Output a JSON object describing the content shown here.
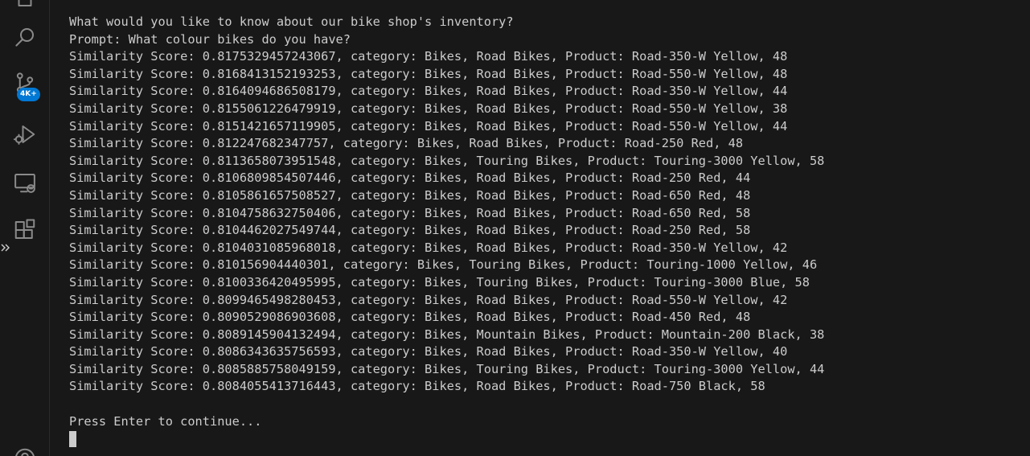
{
  "activity_bar": {
    "icons": [
      "explorer-icon",
      "search-icon",
      "source-control-icon",
      "run-and-debug-icon",
      "remote-explorer-icon",
      "extensions-icon",
      "accounts-icon"
    ],
    "source_control_badge": "4K+",
    "badge_color": "#0078d4"
  },
  "terminal": {
    "header_lines": [
      "What would you like to know about our bike shop's inventory?",
      "Prompt: What colour bikes do you have?"
    ],
    "results": [
      "Similarity Score: 0.8175329457243067, category: Bikes, Road Bikes, Product: Road-350-W Yellow, 48",
      "Similarity Score: 0.8168413152193253, category: Bikes, Road Bikes, Product: Road-550-W Yellow, 48",
      "Similarity Score: 0.8164094686508179, category: Bikes, Road Bikes, Product: Road-350-W Yellow, 44",
      "Similarity Score: 0.8155061226479919, category: Bikes, Road Bikes, Product: Road-550-W Yellow, 38",
      "Similarity Score: 0.8151421657119905, category: Bikes, Road Bikes, Product: Road-550-W Yellow, 44",
      "Similarity Score: 0.812247682347757, category: Bikes, Road Bikes, Product: Road-250 Red, 48",
      "Similarity Score: 0.8113658073951548, category: Bikes, Touring Bikes, Product: Touring-3000 Yellow, 58",
      "Similarity Score: 0.8106809854507446, category: Bikes, Road Bikes, Product: Road-250 Red, 44",
      "Similarity Score: 0.8105861657508527, category: Bikes, Road Bikes, Product: Road-650 Red, 48",
      "Similarity Score: 0.8104758632750406, category: Bikes, Road Bikes, Product: Road-650 Red, 58",
      "Similarity Score: 0.8104462027549744, category: Bikes, Road Bikes, Product: Road-250 Red, 58",
      "Similarity Score: 0.8104031085968018, category: Bikes, Road Bikes, Product: Road-350-W Yellow, 42",
      "Similarity Score: 0.810156904440301, category: Bikes, Touring Bikes, Product: Touring-1000 Yellow, 46",
      "Similarity Score: 0.8100336420495995, category: Bikes, Touring Bikes, Product: Touring-3000 Blue, 58",
      "Similarity Score: 0.8099465498280453, category: Bikes, Road Bikes, Product: Road-550-W Yellow, 42",
      "Similarity Score: 0.8090529086903608, category: Bikes, Road Bikes, Product: Road-450 Red, 48",
      "Similarity Score: 0.8089145904132494, category: Bikes, Mountain Bikes, Product: Mountain-200 Black, 38",
      "Similarity Score: 0.8086343635756593, category: Bikes, Road Bikes, Product: Road-350-W Yellow, 40",
      "Similarity Score: 0.8085885758049159, category: Bikes, Touring Bikes, Product: Touring-3000 Yellow, 44",
      "Similarity Score: 0.8084055413716443, category: Bikes, Road Bikes, Product: Road-750 Black, 58"
    ],
    "footer_prompt": "Press Enter to continue...",
    "text_color": "#cccccc",
    "background_color": "#181818"
  }
}
